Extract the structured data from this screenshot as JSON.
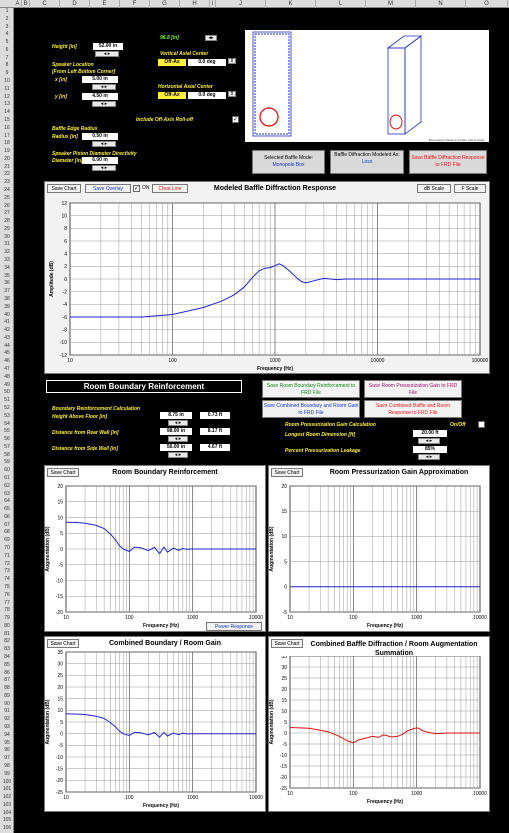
{
  "column_headers": [
    "A",
    "B",
    "C",
    "D",
    "E",
    "F",
    "G",
    "H",
    "I",
    "J",
    "K",
    "L",
    "M",
    "N",
    "O"
  ],
  "row_numbers": [
    "1",
    "2",
    "3",
    "4",
    "5",
    "6",
    "7",
    "8",
    "9",
    "10",
    "11",
    "12",
    "13",
    "14",
    "15",
    "16",
    "17",
    "18",
    "19",
    "20",
    "21",
    "22",
    "23",
    "24",
    "25",
    "26",
    "27",
    "28",
    "29",
    "30",
    "31",
    "32",
    "33",
    "34",
    "35",
    "36",
    "37",
    "38",
    "39",
    "40",
    "41",
    "42",
    "43",
    "44",
    "45",
    "46",
    "47",
    "48",
    "49",
    "50",
    "51",
    "52",
    "53",
    "54",
    "55",
    "56",
    "57",
    "58",
    "59",
    "60",
    "61",
    "62",
    "63",
    "64",
    "65",
    "66",
    "67",
    "68",
    "69",
    "70",
    "71",
    "72",
    "73",
    "74",
    "75",
    "76",
    "77",
    "78",
    "79",
    "80",
    "81",
    "82",
    "83",
    "84",
    "85",
    "86",
    "87",
    "88",
    "89",
    "90",
    "91",
    "92",
    "93",
    "94",
    "95",
    "96",
    "97",
    "98",
    "99",
    "100",
    "101",
    "102",
    "103",
    "104",
    "105",
    "106"
  ],
  "baffle": {
    "top_value": "96.8 [in]",
    "height_label": "Height [in]",
    "height_value": "52.00 in",
    "speaker_location_label": "Speaker Location",
    "speaker_location_sub": "[From Left Bottom Corner]",
    "x_label": "x [in]",
    "x_value": "5.00 in",
    "y_label": "y [in]",
    "y_value": "4.50 in",
    "vertical_axis_label": "Vertical Axial Center",
    "vertical_axis_value": "0.0 deg",
    "vertical_axis_tag": "Off-Ax",
    "horizontal_axis_label": "Horizontal Axial Center",
    "horizontal_axis_value": "0.0 deg",
    "horizontal_axis_tag": "Off-Ax",
    "offaxis_label": "Include Off-Axis Roll-off",
    "edge_radius_label": "Baffle Edge Radius",
    "radius_label": "Radius [in]",
    "radius_value": "0.50 in",
    "piston_label": "Speaker Piston Diameter Directivity",
    "diameter_label": "Diameter [in]",
    "diameter_value": "6.00 in",
    "preview_caption": "Dimensions shown in inches. Not to scale.",
    "selected_mode_label": "Selected Baffle Mode:",
    "selected_mode_value": "Monopole Box",
    "modeled_as_label": "Baffle Diffraction Modeled As:",
    "modeled_as_value": "Loss",
    "save_frd_label": "Save Baffle Diffraction Response to FRD File"
  },
  "diffraction_chart": {
    "save_chart": "Save Chart",
    "save_overlay": "Save Overlay",
    "on_label": "ON",
    "clear_line": "Clear Line",
    "db_scale": "dB Scale",
    "f_scale": "F Scale"
  },
  "room": {
    "header": "Room Boundary Reinforcement",
    "calc_label": "Boundary Reinforcement Calculation",
    "height_floor_label": "Height Above Floor [in]",
    "height_floor_value": "8.75 in",
    "height_floor_ft": "0.73 ft",
    "rear_wall_label": "Distance from Rear Wall [in]",
    "rear_wall_value": "98.00 in",
    "rear_wall_ft": "8.17 ft",
    "side_wall_label": "Distance from Side Wall [in]",
    "side_wall_value": "56.00 in",
    "side_wall_ft": "4.67 ft",
    "save_boundary": "Save Room Boundary Reinforcement to FRD File",
    "save_pressurization": "Save Room Pressurization Gain to FRD File",
    "save_combined": "Save Combined Boundary and Room Gain to FRD File",
    "save_combined_baffle": "Save Combined Baffle and Room Response to FRD File",
    "pressurization_label": "Room Pressurization Gain Calculation",
    "onoff_label": "On/Off",
    "longest_label": "Longest Room Dimension [ft]",
    "longest_value": "20.00 ft",
    "leakage_label": "Percent Pressurization Leakage",
    "leakage_value": "85%",
    "power_response": "Power Response"
  },
  "chart_data": [
    {
      "type": "line",
      "title": "Modeled Baffle Diffraction Response",
      "xlabel": "Frequency (Hz)",
      "ylabel": "Amplitude (dB)",
      "xscale": "log",
      "xlim": [
        10,
        100000
      ],
      "ylim": [
        -12,
        12
      ],
      "xticks": [
        10,
        100,
        1000,
        10000,
        100000
      ],
      "yticks": [
        12,
        10,
        8,
        6,
        4,
        2,
        0,
        -2,
        -4,
        -6,
        -8,
        -10,
        -12
      ],
      "grid": true,
      "color": "#2222cc",
      "x": [
        10,
        50,
        100,
        200,
        300,
        400,
        500,
        600,
        700,
        800,
        900,
        1000,
        1100,
        1200,
        1400,
        1600,
        1800,
        2000,
        2500,
        3000,
        4000,
        5000,
        7000,
        10000,
        20000,
        50000,
        100000
      ],
      "y": [
        -6,
        -6,
        -5.6,
        -4.5,
        -3.5,
        -2.5,
        -1.3,
        0.2,
        1.3,
        1.7,
        1.8,
        2.1,
        2.4,
        2.1,
        1.2,
        0.3,
        -0.4,
        -0.6,
        -0.2,
        0.1,
        -0.1,
        0,
        0,
        0,
        0,
        0,
        0
      ]
    },
    {
      "type": "line",
      "title": "Room Boundary Reinforcement",
      "xlabel": "Frequency (Hz)",
      "ylabel": "Augmentation (dB)",
      "xscale": "log",
      "xlim": [
        10,
        10000
      ],
      "ylim": [
        -20,
        20
      ],
      "xticks": [
        10,
        100,
        1000,
        10000
      ],
      "yticks": [
        20,
        15,
        10,
        5,
        0,
        -5,
        -10,
        -15,
        -20
      ],
      "grid": true,
      "color": "#2222cc",
      "x": [
        10,
        15,
        20,
        30,
        40,
        50,
        60,
        70,
        80,
        100,
        120,
        150,
        200,
        250,
        300,
        350,
        400,
        500,
        600,
        700,
        800,
        1000,
        2000,
        10000
      ],
      "y": [
        8.5,
        8.4,
        8.2,
        7.5,
        6.5,
        4.8,
        3,
        1,
        0,
        -0.8,
        0.6,
        0.4,
        -0.5,
        0.5,
        -1.5,
        0.6,
        -1,
        0.3,
        -0.4,
        0.2,
        -0.1,
        0,
        0,
        0
      ]
    },
    {
      "type": "line",
      "title": "Room Pressurization Gain Approximation",
      "xlabel": "Frequency (Hz)",
      "ylabel": "Augmentation (dB)",
      "xscale": "log",
      "xlim": [
        10,
        10000
      ],
      "ylim": [
        -5,
        20
      ],
      "xticks": [
        10,
        100,
        1000,
        10000
      ],
      "yticks": [
        20,
        15,
        10,
        5,
        0,
        -5
      ],
      "grid": true,
      "color": "#2222cc",
      "x": [
        10,
        10000
      ],
      "y": [
        0,
        0
      ]
    },
    {
      "type": "line",
      "title": "Combined Boundary / Room Gain",
      "xlabel": "Frequency (Hz)",
      "ylabel": "Augmentation (dB)",
      "xscale": "log",
      "xlim": [
        10,
        10000
      ],
      "ylim": [
        -25,
        35
      ],
      "xticks": [
        10,
        100,
        1000,
        10000
      ],
      "yticks": [
        35,
        30,
        25,
        20,
        15,
        10,
        5,
        0,
        -5,
        -10,
        -15,
        -20,
        -25
      ],
      "grid": true,
      "color": "#2222cc",
      "x": [
        10,
        15,
        20,
        30,
        40,
        50,
        60,
        70,
        80,
        100,
        120,
        150,
        200,
        250,
        300,
        350,
        400,
        500,
        600,
        700,
        800,
        1000,
        2000,
        10000
      ],
      "y": [
        8.5,
        8.4,
        8.2,
        7.5,
        6.5,
        4.8,
        3,
        1,
        0,
        -0.8,
        0.6,
        0.4,
        -0.5,
        0.5,
        -1.5,
        0.6,
        -1,
        0.3,
        -0.4,
        0.2,
        -0.1,
        0,
        0,
        0
      ]
    },
    {
      "type": "line",
      "title": "Combined Baffle Diffraction / Room Augmentation Summation",
      "xlabel": "Frequency (Hz)",
      "ylabel": "Augmentation (dB)",
      "xscale": "log",
      "xlim": [
        10,
        10000
      ],
      "ylim": [
        -25,
        35
      ],
      "xticks": [
        10,
        100,
        1000,
        10000
      ],
      "yticks": [
        35,
        30,
        25,
        20,
        15,
        10,
        5,
        0,
        -5,
        -10,
        -15,
        -20,
        -25
      ],
      "grid": true,
      "color": "#dd1111",
      "x": [
        10,
        20,
        40,
        60,
        80,
        100,
        120,
        150,
        200,
        250,
        300,
        400,
        500,
        600,
        700,
        800,
        900,
        1000,
        1100,
        1200,
        1500,
        2000,
        3000,
        5000,
        10000
      ],
      "y": [
        2.5,
        2.2,
        0.6,
        -1.5,
        -3.5,
        -4.5,
        -3.2,
        -2.5,
        -1.5,
        -2,
        -0.8,
        -1.8,
        -1.5,
        -0.6,
        0.8,
        1.5,
        2,
        2.3,
        2.1,
        1.2,
        0.3,
        -0.3,
        0,
        0,
        0
      ]
    }
  ]
}
